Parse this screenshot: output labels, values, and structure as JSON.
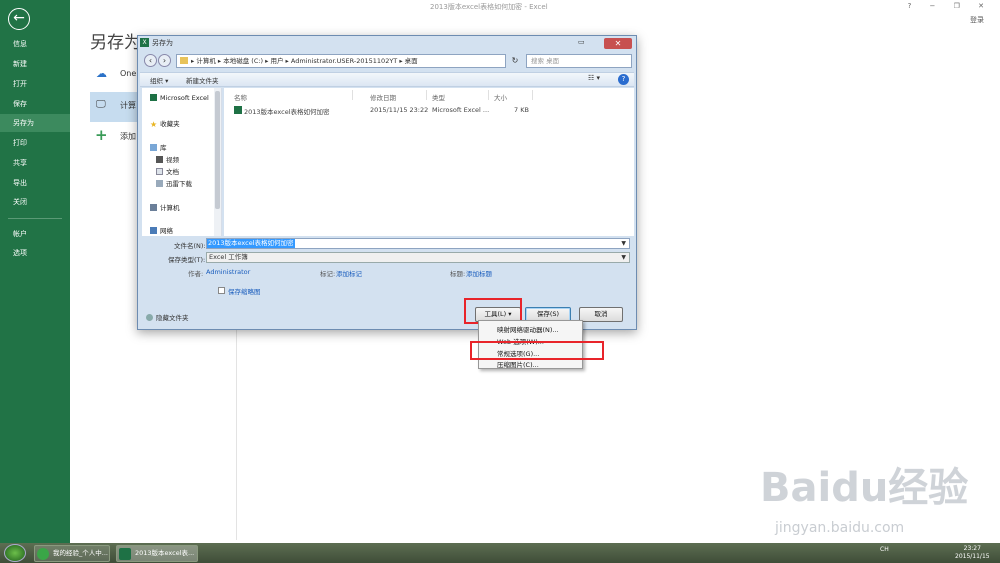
{
  "app": {
    "title": "2013版本excel表格如何加密 - Excel",
    "login": "登录",
    "window_controls": "? − ❐ ✕"
  },
  "sidebar": {
    "items": [
      {
        "label": "信息"
      },
      {
        "label": "新建"
      },
      {
        "label": "打开"
      },
      {
        "label": "保存"
      },
      {
        "label": "另存为"
      },
      {
        "label": "打印"
      },
      {
        "label": "共享"
      },
      {
        "label": "导出"
      },
      {
        "label": "关闭"
      },
      {
        "label": "帐户"
      },
      {
        "label": "选项"
      }
    ]
  },
  "backstage": {
    "heading": "另存为",
    "locations": [
      {
        "label": "One"
      },
      {
        "label": "计算"
      },
      {
        "label": "添加"
      }
    ]
  },
  "dialog": {
    "title": "另存为",
    "address": "▸ 计算机 ▸ 本地磁盘 (C:) ▸ 用户 ▸ Administrator.USER-20151102YT ▸ 桌面",
    "search_placeholder": "搜索 桌面",
    "toolbar": {
      "organize": "组织 ▾",
      "new_folder": "新建文件夹"
    },
    "nav": [
      {
        "label": "Microsoft Excel"
      },
      {
        "label": "收藏夹"
      },
      {
        "label": "库"
      },
      {
        "label": "视频"
      },
      {
        "label": "文档"
      },
      {
        "label": "迅雷下载"
      },
      {
        "label": "计算机"
      },
      {
        "label": "网络"
      }
    ],
    "columns": {
      "name": "名称",
      "modified": "修改日期",
      "type": "类型",
      "size": "大小"
    },
    "file": {
      "name": "2013版本excel表格如何加密",
      "modified": "2015/11/15 23:22",
      "type": "Microsoft Excel ...",
      "size": "7 KB"
    },
    "filename_label": "文件名(N):",
    "filename_value": "2013版本excel表格如何加密",
    "filetype_label": "保存类型(T):",
    "filetype_value": "Excel 工作簿",
    "author_label": "作者:",
    "author_value": "Administrator",
    "tags_label": "标记:",
    "tags_value": "添加标记",
    "subject_label": "标题:",
    "subject_value": "添加标题",
    "thumbnail_label": "保存缩略图",
    "hide_folders": "隐藏文件夹",
    "tools_button": "工具(L)",
    "save_button": "保存(S)",
    "cancel_button": "取消"
  },
  "tools_menu": [
    {
      "label": "映射网络驱动器(N)..."
    },
    {
      "label": "Web 选项(W)..."
    },
    {
      "label": "常规选项(G)..."
    },
    {
      "label": "压缩图片(C)..."
    }
  ],
  "taskbar": {
    "items": [
      {
        "label": "我的经验_个人中..."
      },
      {
        "label": "2013版本excel表..."
      }
    ],
    "tray": "CH",
    "time": "23:27",
    "date": "2015/11/15"
  },
  "watermark": {
    "brand": "Baidu经验",
    "url": "jingyan.baidu.com"
  }
}
